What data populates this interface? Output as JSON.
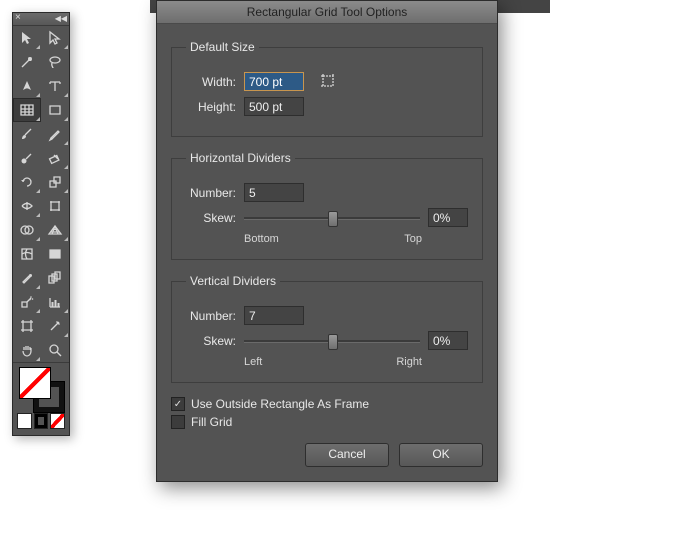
{
  "dialog": {
    "title": "Rectangular Grid Tool Options",
    "groups": {
      "size": {
        "title": "Default Size",
        "width_label": "Width:",
        "width_value": "700 pt",
        "height_label": "Height:",
        "height_value": "500 pt"
      },
      "hdiv": {
        "title": "Horizontal Dividers",
        "number_label": "Number:",
        "number_value": "5",
        "skew_label": "Skew:",
        "skew_value": "0%",
        "skew_left": "Bottom",
        "skew_right": "Top"
      },
      "vdiv": {
        "title": "Vertical Dividers",
        "number_label": "Number:",
        "number_value": "7",
        "skew_label": "Skew:",
        "skew_value": "0%",
        "skew_left": "Left",
        "skew_right": "Right"
      }
    },
    "checks": {
      "use_outside": {
        "label": "Use Outside Rectangle As Frame",
        "checked": true
      },
      "fill_grid": {
        "label": "Fill Grid",
        "checked": false
      }
    },
    "buttons": {
      "cancel": "Cancel",
      "ok": "OK"
    }
  }
}
